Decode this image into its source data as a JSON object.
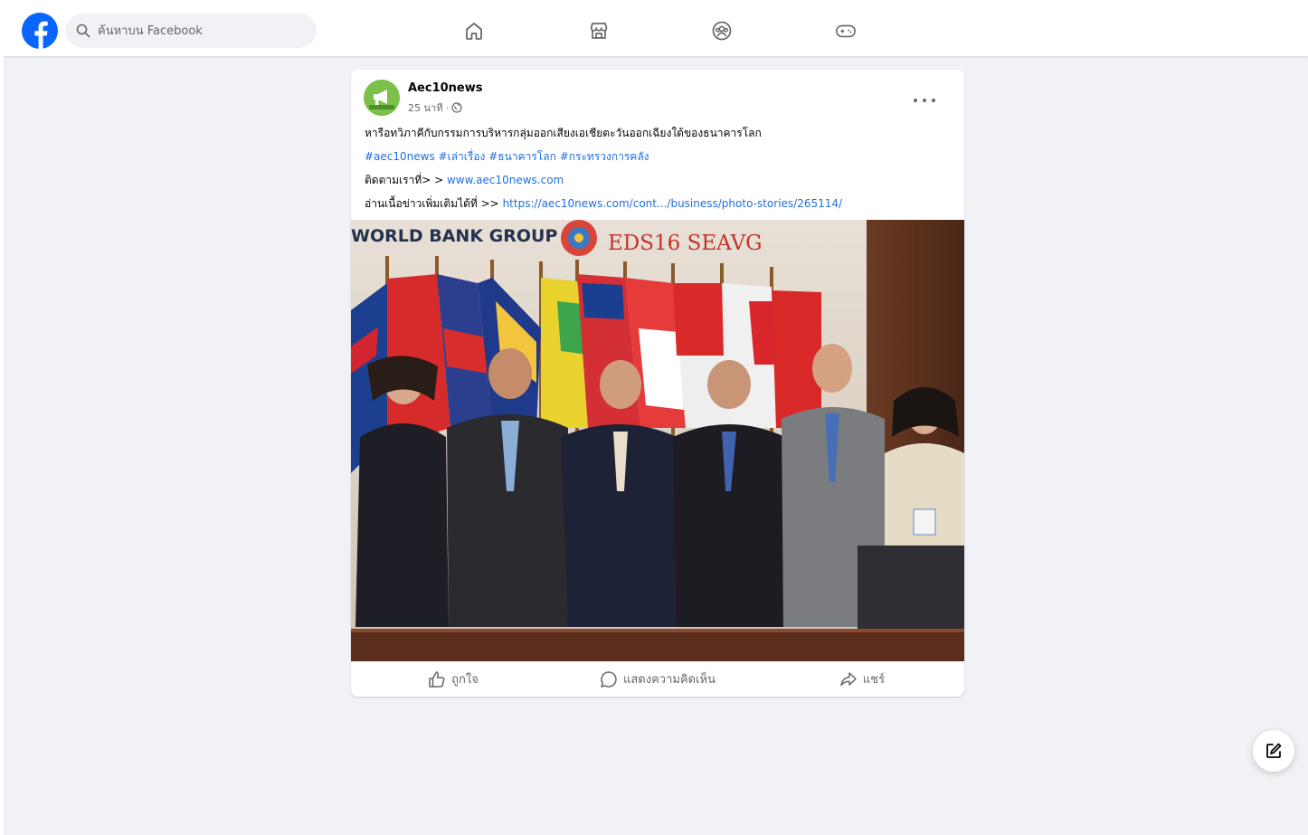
{
  "search": {
    "placeholder": "ค้นหาบน Facebook"
  },
  "nav": {
    "items": [
      {
        "name": "home"
      },
      {
        "name": "marketplace"
      },
      {
        "name": "groups"
      },
      {
        "name": "gaming"
      }
    ]
  },
  "post": {
    "page_name": "Aec10news",
    "time": "25 นาที ·",
    "caption": "หารือทวิภาคีกับกรรมการบริหารกลุ่มออกเสียงเอเชียตะวันออกเฉียงใต้ของธนาคารโลก",
    "hashtags": [
      "#aec10news",
      "#เล่าเรื่อง",
      "#ธนาคารโลก",
      "#กระทรวงการคลัง"
    ],
    "follow_prefix": "ติดตามเราที่> >",
    "follow_link": "www.aec10news.com",
    "read_more_prefix": "อ่านเนื้อข่าวเพิ่มเติมได้ที่ >>",
    "read_more_link": "https://aec10news.com/cont.../business/photo-stories/265114/",
    "image": {
      "banner_left": "WORLD BANK GROUP",
      "banner_right": "EDS16 SEAVG"
    },
    "actions": {
      "like": "ถูกใจ",
      "comment": "แสดงความคิดเห็น",
      "share": "แชร์"
    }
  },
  "colors": {
    "brand": "#0866ff",
    "link": "#216fdb",
    "background": "#f0f2f5"
  }
}
